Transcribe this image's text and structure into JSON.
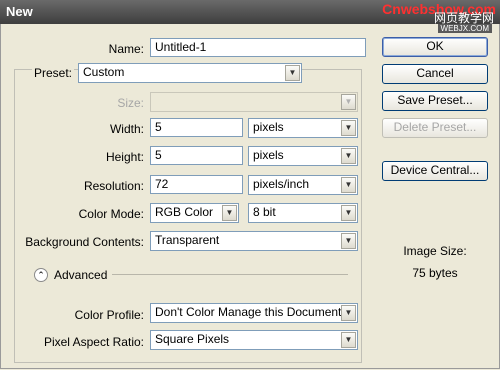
{
  "window": {
    "title": "New",
    "watermark_site": "Cnwebshow.com",
    "watermark_cn": "网页教学网",
    "watermark_url": "WEBJX.COM"
  },
  "fields": {
    "name": {
      "label": "Name:",
      "value": "Untitled-1"
    },
    "preset": {
      "label": "Preset:",
      "value": "Custom"
    },
    "size": {
      "label": "Size:",
      "value": ""
    },
    "width": {
      "label": "Width:",
      "value": "5",
      "unit": "pixels"
    },
    "height": {
      "label": "Height:",
      "value": "5",
      "unit": "pixels"
    },
    "resolution": {
      "label": "Resolution:",
      "value": "72",
      "unit": "pixels/inch"
    },
    "color_mode": {
      "label": "Color Mode:",
      "value": "RGB Color",
      "depth": "8 bit"
    },
    "background": {
      "label": "Background Contents:",
      "value": "Transparent"
    },
    "advanced": {
      "label": "Advanced"
    },
    "color_profile": {
      "label": "Color Profile:",
      "value": "Don't Color Manage this Document"
    },
    "pixel_aspect": {
      "label": "Pixel Aspect Ratio:",
      "value": "Square Pixels"
    }
  },
  "buttons": {
    "ok": "OK",
    "cancel": "Cancel",
    "save_preset": "Save Preset...",
    "delete_preset": "Delete Preset...",
    "device_central": "Device Central..."
  },
  "info": {
    "image_size_label": "Image Size:",
    "image_size_value": "75 bytes"
  }
}
